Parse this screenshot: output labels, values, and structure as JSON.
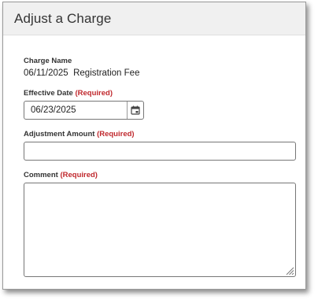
{
  "dialog": {
    "title": "Adjust a Charge"
  },
  "charge_name": {
    "label": "Charge Name",
    "value": "06/11/2025  Registration Fee"
  },
  "effective_date": {
    "label": "Effective Date",
    "required": "(Required)",
    "value": "06/23/2025",
    "icon": "calendar-icon"
  },
  "adjustment_amount": {
    "label": "Adjustment Amount",
    "required": "(Required)",
    "value": ""
  },
  "comment": {
    "label": "Comment",
    "required": "(Required)",
    "value": ""
  },
  "colors": {
    "required": "#c0282d",
    "header_bg": "#f0f0f0"
  }
}
